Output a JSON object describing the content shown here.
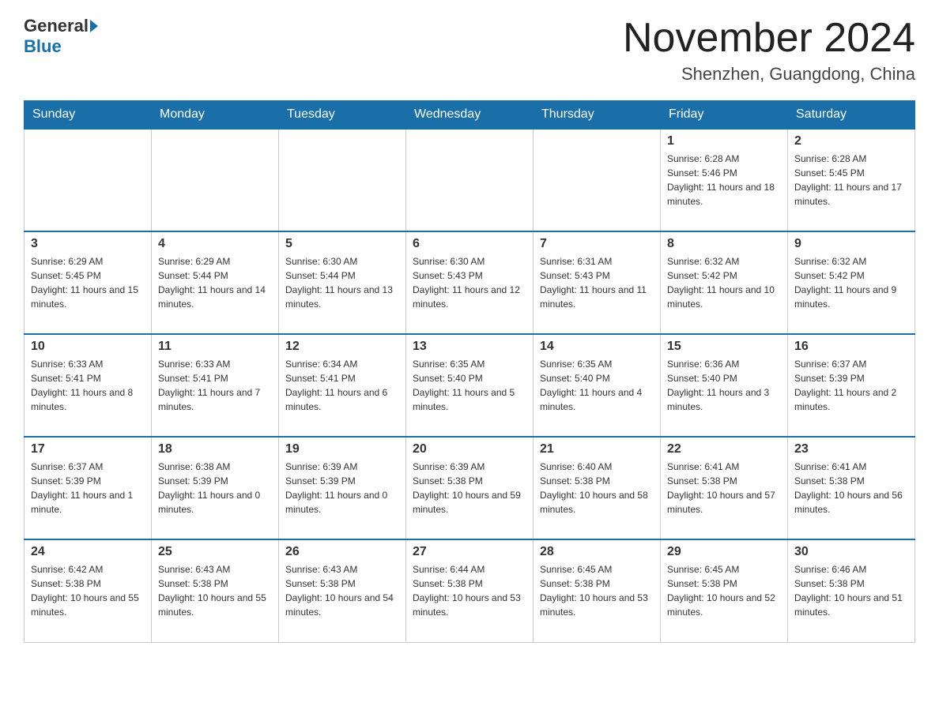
{
  "header": {
    "logo": {
      "general": "General",
      "blue": "Blue"
    },
    "title": "November 2024",
    "location": "Shenzhen, Guangdong, China"
  },
  "weekdays": [
    "Sunday",
    "Monday",
    "Tuesday",
    "Wednesday",
    "Thursday",
    "Friday",
    "Saturday"
  ],
  "weeks": [
    [
      {
        "day": "",
        "info": ""
      },
      {
        "day": "",
        "info": ""
      },
      {
        "day": "",
        "info": ""
      },
      {
        "day": "",
        "info": ""
      },
      {
        "day": "",
        "info": ""
      },
      {
        "day": "1",
        "info": "Sunrise: 6:28 AM\nSunset: 5:46 PM\nDaylight: 11 hours and 18 minutes."
      },
      {
        "day": "2",
        "info": "Sunrise: 6:28 AM\nSunset: 5:45 PM\nDaylight: 11 hours and 17 minutes."
      }
    ],
    [
      {
        "day": "3",
        "info": "Sunrise: 6:29 AM\nSunset: 5:45 PM\nDaylight: 11 hours and 15 minutes."
      },
      {
        "day": "4",
        "info": "Sunrise: 6:29 AM\nSunset: 5:44 PM\nDaylight: 11 hours and 14 minutes."
      },
      {
        "day": "5",
        "info": "Sunrise: 6:30 AM\nSunset: 5:44 PM\nDaylight: 11 hours and 13 minutes."
      },
      {
        "day": "6",
        "info": "Sunrise: 6:30 AM\nSunset: 5:43 PM\nDaylight: 11 hours and 12 minutes."
      },
      {
        "day": "7",
        "info": "Sunrise: 6:31 AM\nSunset: 5:43 PM\nDaylight: 11 hours and 11 minutes."
      },
      {
        "day": "8",
        "info": "Sunrise: 6:32 AM\nSunset: 5:42 PM\nDaylight: 11 hours and 10 minutes."
      },
      {
        "day": "9",
        "info": "Sunrise: 6:32 AM\nSunset: 5:42 PM\nDaylight: 11 hours and 9 minutes."
      }
    ],
    [
      {
        "day": "10",
        "info": "Sunrise: 6:33 AM\nSunset: 5:41 PM\nDaylight: 11 hours and 8 minutes."
      },
      {
        "day": "11",
        "info": "Sunrise: 6:33 AM\nSunset: 5:41 PM\nDaylight: 11 hours and 7 minutes."
      },
      {
        "day": "12",
        "info": "Sunrise: 6:34 AM\nSunset: 5:41 PM\nDaylight: 11 hours and 6 minutes."
      },
      {
        "day": "13",
        "info": "Sunrise: 6:35 AM\nSunset: 5:40 PM\nDaylight: 11 hours and 5 minutes."
      },
      {
        "day": "14",
        "info": "Sunrise: 6:35 AM\nSunset: 5:40 PM\nDaylight: 11 hours and 4 minutes."
      },
      {
        "day": "15",
        "info": "Sunrise: 6:36 AM\nSunset: 5:40 PM\nDaylight: 11 hours and 3 minutes."
      },
      {
        "day": "16",
        "info": "Sunrise: 6:37 AM\nSunset: 5:39 PM\nDaylight: 11 hours and 2 minutes."
      }
    ],
    [
      {
        "day": "17",
        "info": "Sunrise: 6:37 AM\nSunset: 5:39 PM\nDaylight: 11 hours and 1 minute."
      },
      {
        "day": "18",
        "info": "Sunrise: 6:38 AM\nSunset: 5:39 PM\nDaylight: 11 hours and 0 minutes."
      },
      {
        "day": "19",
        "info": "Sunrise: 6:39 AM\nSunset: 5:39 PM\nDaylight: 11 hours and 0 minutes."
      },
      {
        "day": "20",
        "info": "Sunrise: 6:39 AM\nSunset: 5:38 PM\nDaylight: 10 hours and 59 minutes."
      },
      {
        "day": "21",
        "info": "Sunrise: 6:40 AM\nSunset: 5:38 PM\nDaylight: 10 hours and 58 minutes."
      },
      {
        "day": "22",
        "info": "Sunrise: 6:41 AM\nSunset: 5:38 PM\nDaylight: 10 hours and 57 minutes."
      },
      {
        "day": "23",
        "info": "Sunrise: 6:41 AM\nSunset: 5:38 PM\nDaylight: 10 hours and 56 minutes."
      }
    ],
    [
      {
        "day": "24",
        "info": "Sunrise: 6:42 AM\nSunset: 5:38 PM\nDaylight: 10 hours and 55 minutes."
      },
      {
        "day": "25",
        "info": "Sunrise: 6:43 AM\nSunset: 5:38 PM\nDaylight: 10 hours and 55 minutes."
      },
      {
        "day": "26",
        "info": "Sunrise: 6:43 AM\nSunset: 5:38 PM\nDaylight: 10 hours and 54 minutes."
      },
      {
        "day": "27",
        "info": "Sunrise: 6:44 AM\nSunset: 5:38 PM\nDaylight: 10 hours and 53 minutes."
      },
      {
        "day": "28",
        "info": "Sunrise: 6:45 AM\nSunset: 5:38 PM\nDaylight: 10 hours and 53 minutes."
      },
      {
        "day": "29",
        "info": "Sunrise: 6:45 AM\nSunset: 5:38 PM\nDaylight: 10 hours and 52 minutes."
      },
      {
        "day": "30",
        "info": "Sunrise: 6:46 AM\nSunset: 5:38 PM\nDaylight: 10 hours and 51 minutes."
      }
    ]
  ]
}
